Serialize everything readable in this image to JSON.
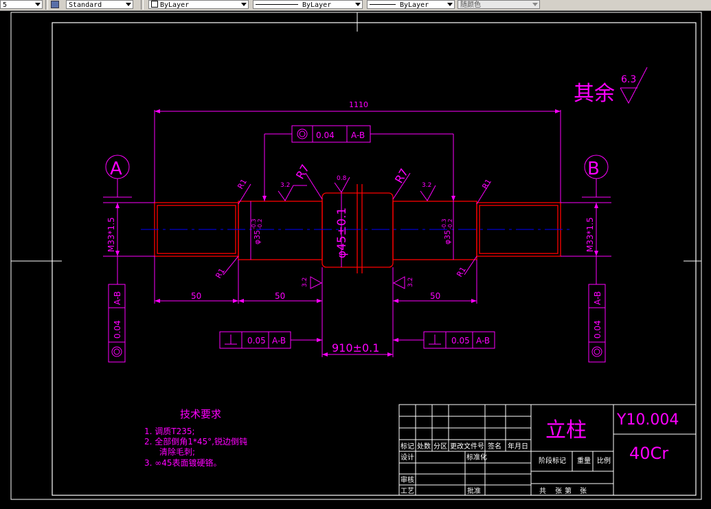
{
  "toolbar": {
    "layer_value": "5",
    "text_style": "Standard",
    "color": "ByLayer",
    "linetype": "ByLayer",
    "lineweight": "ByLayer",
    "plot_style": "随颜色"
  },
  "drawing": {
    "surface_rest_label": "其余",
    "surface_rest_value": "6.3",
    "overall_length": "1110",
    "runout_value": "0.04",
    "runout_datum": "A-B",
    "datum_a": "A",
    "datum_b": "B",
    "thread": "M33*1.5",
    "center_diameter": "φ45±0.1",
    "shoulder_diameter_left": "φ35",
    "shoulder_diameter_right": "φ35",
    "tol_upper": "-0.3",
    "tol_lower": "-0.2",
    "radius_r7": "R7",
    "radius_r1": "R1",
    "roughness_32": "3.2",
    "roughness_08": "0.8",
    "dim_50": "50",
    "dim_910": "910±0.1",
    "perp_value": "0.05",
    "perp_datum": "A-B"
  },
  "tech_requirements": {
    "title": "技术要求",
    "items": [
      "1. 调质T235;",
      "2. 全部倒角1*45°,锐边倒钝",
      "清除毛刺;",
      "3. ∞45表面镀硬铬。"
    ]
  },
  "title_block": {
    "part_name": "立柱",
    "drawing_number": "Y10.004",
    "material": "40Cr",
    "labels": {
      "mark": "标记",
      "count": "处数",
      "zone": "分区",
      "change_doc": "更改文件号",
      "signature": "签名",
      "date": "年月日",
      "design": "设计",
      "standardize": "标准化",
      "review": "审核",
      "process": "工艺",
      "approve": "批准",
      "stage_mark": "阶段标记",
      "weight": "重量",
      "scale": "比例",
      "total": "共",
      "sheets": "张",
      "sheet_no": "第",
      "sheet_unit": "张"
    }
  },
  "colors": {
    "magenta": "#ff00ff",
    "red": "#ff0000",
    "blue": "#0000ff",
    "white": "#ffffff"
  }
}
